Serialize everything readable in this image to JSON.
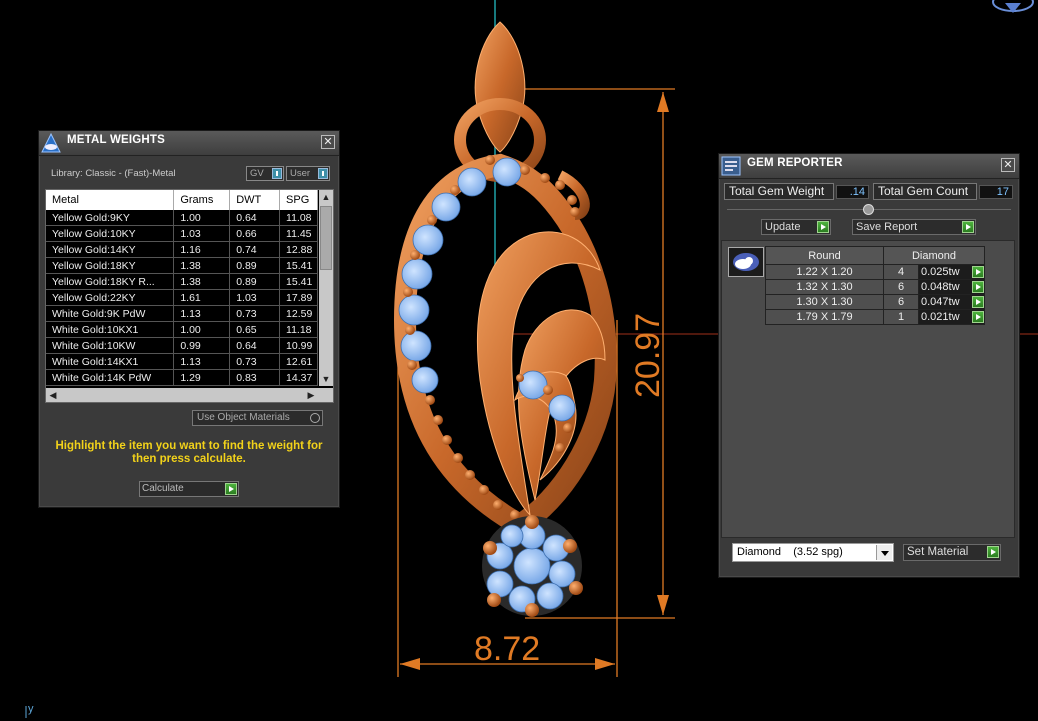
{
  "colors": {
    "background": "#000000",
    "orange": "#e07a24",
    "accent_green": "#3fa034",
    "hint_yellow": "#f2d21a",
    "gem_blue": "#8fbff0"
  },
  "viewport": {
    "dimension_height": "20.97",
    "dimension_width": "8.72",
    "axis_label": "y"
  },
  "metal_weights": {
    "title": "METAL WEIGHTS",
    "close_label": "✕",
    "library": "Library: Classic - (Fast)-Metal",
    "toggle_gv": "GV",
    "toggle_user": "User",
    "columns": [
      "Metal",
      "Grams",
      "DWT",
      "SPG"
    ],
    "rows": [
      [
        "Yellow Gold:9KY",
        "1.00",
        "0.64",
        "11.08"
      ],
      [
        "Yellow Gold:10KY",
        "1.03",
        "0.66",
        "11.45"
      ],
      [
        "Yellow Gold:14KY",
        "1.16",
        "0.74",
        "12.88"
      ],
      [
        "Yellow Gold:18KY",
        "1.38",
        "0.89",
        "15.41"
      ],
      [
        "Yellow Gold:18KY R...",
        "1.38",
        "0.89",
        "15.41"
      ],
      [
        "Yellow Gold:22KY",
        "1.61",
        "1.03",
        "17.89"
      ],
      [
        "White Gold:9K PdW",
        "1.13",
        "0.73",
        "12.59"
      ],
      [
        "White Gold:10KX1",
        "1.00",
        "0.65",
        "11.18"
      ],
      [
        "White Gold:10KW",
        "0.99",
        "0.64",
        "10.99"
      ],
      [
        "White Gold:14KX1",
        "1.13",
        "0.73",
        "12.61"
      ],
      [
        "White Gold:14K PdW",
        "1.29",
        "0.83",
        "14.37"
      ]
    ],
    "use_object_materials": "Use Object Materials",
    "hint": "Highlight the item you want to find the weight for then press calculate.",
    "calculate": "Calculate"
  },
  "gem_reporter": {
    "title": "GEM REPORTER",
    "close_label": "✕",
    "total_weight_label": "Total Gem Weight",
    "total_weight_value": ".14",
    "total_count_label": "Total Gem Count",
    "total_count_value": "17",
    "update": "Update",
    "save_report": "Save Report",
    "columns": [
      "Round",
      "Diamond"
    ],
    "rows": [
      {
        "size": "1.22 X 1.20",
        "count": "4",
        "weight": "0.025tw"
      },
      {
        "size": "1.32 X 1.30",
        "count": "6",
        "weight": "0.048tw"
      },
      {
        "size": "1.30 X 1.30",
        "count": "6",
        "weight": "0.047tw"
      },
      {
        "size": "1.79 X 1.79",
        "count": "1",
        "weight": "0.021tw"
      }
    ],
    "material_select": "Diamond    (3.52 spg)",
    "set_material": "Set Material"
  }
}
